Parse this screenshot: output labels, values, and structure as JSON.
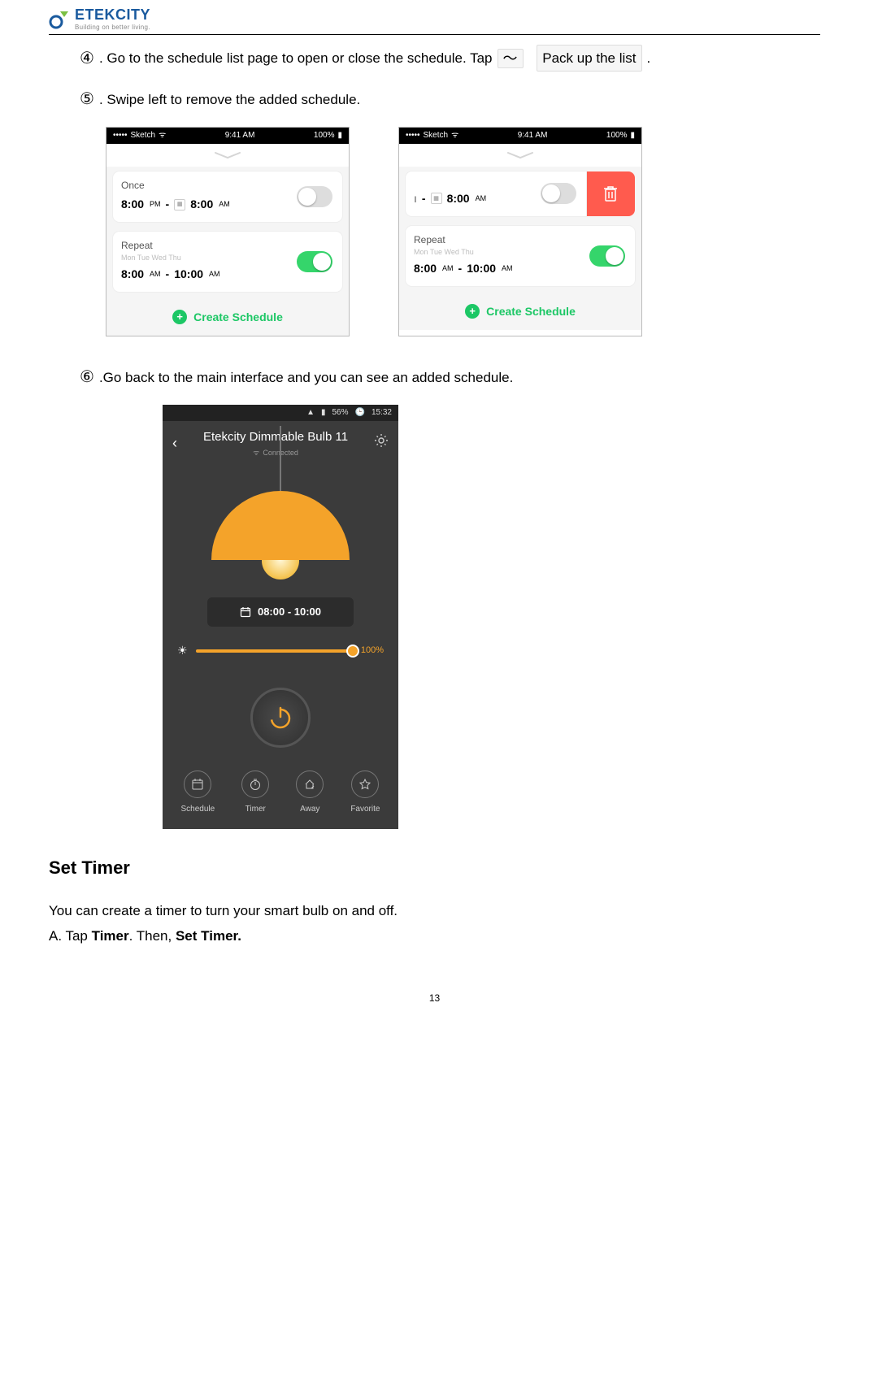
{
  "header": {
    "brand": "ETEKCITY",
    "tagline": "Building on better living."
  },
  "steps": {
    "s4": {
      "num": "④",
      "pre": ". Go to the schedule list page to open or close the schedule. Tap",
      "glyph": "〜",
      "packup": "Pack up the list",
      "post": "."
    },
    "s5": {
      "num": "⑤",
      "text": ". Swipe left to remove the added schedule."
    },
    "s6": {
      "num": "⑥",
      "text": ".Go back to the main interface and you can see an added schedule."
    }
  },
  "statusbar": {
    "carrier": "Sketch",
    "time": "9:41 AM",
    "battery": "100%"
  },
  "shots": {
    "left": {
      "card1": {
        "label": "Once",
        "t1": "8:00",
        "m1": "PM",
        "t2": "8:00",
        "m2": "AM"
      },
      "card2": {
        "label": "Repeat",
        "days": "Mon Tue Wed Thu",
        "t1": "8:00",
        "m1": "AM",
        "t2": "10:00",
        "m2": "AM"
      },
      "create": "Create Schedule"
    },
    "right": {
      "card1": {
        "t1": "8:00",
        "m1": "AM"
      },
      "card2": {
        "label": "Repeat",
        "days": "Mon Tue Wed Thu",
        "t1": "8:00",
        "m1": "AM",
        "t2": "10:00",
        "m2": "AM"
      },
      "create": "Create Schedule"
    }
  },
  "phone3": {
    "status_right": "56%",
    "status_time": "15:32",
    "title": "Etekcity Dimmable Bulb 11",
    "connected": "Connected",
    "sched": "08:00 - 10:00",
    "pct": "100%",
    "nav": {
      "a": "Schedule",
      "b": "Timer",
      "c": "Away",
      "d": "Favorite"
    }
  },
  "section": {
    "title": "Set Timer",
    "para": "You can create a timer to turn your smart bulb on and off.",
    "bullet_prefix": "A.   Tap ",
    "bullet_strong1": "Timer",
    "bullet_mid": ". Then, ",
    "bullet_strong2": "Set Timer."
  },
  "page_number": "13"
}
